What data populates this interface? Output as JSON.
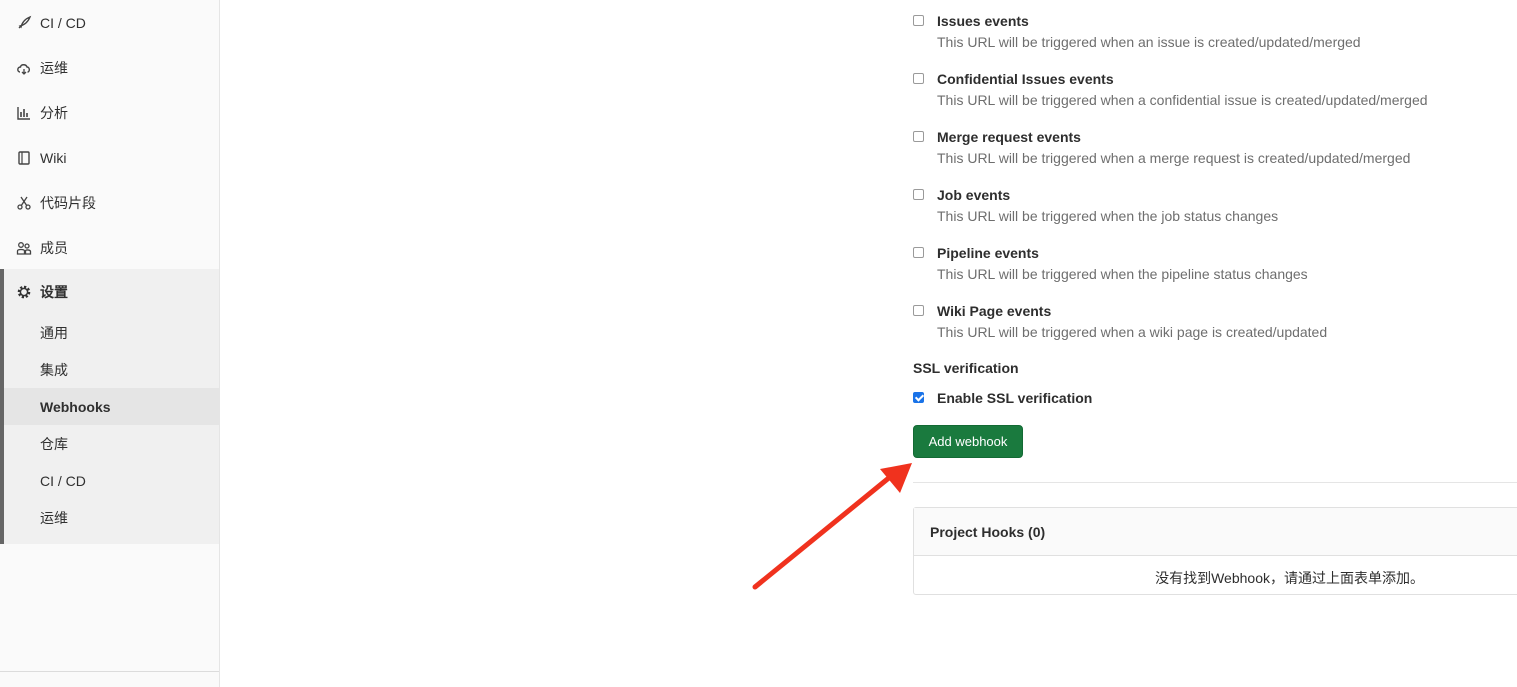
{
  "sidebar": {
    "items": [
      {
        "label": "CI / CD",
        "icon": "rocket-icon"
      },
      {
        "label": "运维",
        "icon": "cloud-icon"
      },
      {
        "label": "分析",
        "icon": "chart-icon"
      },
      {
        "label": "Wiki",
        "icon": "book-icon"
      },
      {
        "label": "代码片段",
        "icon": "scissors-icon"
      },
      {
        "label": "成员",
        "icon": "users-icon"
      },
      {
        "label": "设置",
        "icon": "gear-icon"
      }
    ],
    "settings_sub": [
      "通用",
      "集成",
      "Webhooks",
      "仓库",
      "CI / CD",
      "运维"
    ],
    "active_sub": "Webhooks"
  },
  "events": [
    {
      "title": "Issues events",
      "desc": "This URL will be triggered when an issue is created/updated/merged",
      "checked": false
    },
    {
      "title": "Confidential Issues events",
      "desc": "This URL will be triggered when a confidential issue is created/updated/merged",
      "checked": false
    },
    {
      "title": "Merge request events",
      "desc": "This URL will be triggered when a merge request is created/updated/merged",
      "checked": false
    },
    {
      "title": "Job events",
      "desc": "This URL will be triggered when the job status changes",
      "checked": false
    },
    {
      "title": "Pipeline events",
      "desc": "This URL will be triggered when the pipeline status changes",
      "checked": false
    },
    {
      "title": "Wiki Page events",
      "desc": "This URL will be triggered when a wiki page is created/updated",
      "checked": false
    }
  ],
  "ssl": {
    "heading": "SSL verification",
    "label": "Enable SSL verification",
    "checked": true
  },
  "add_button": "Add webhook",
  "hooks": {
    "title": "Project Hooks (0)",
    "empty": "没有找到Webhook，请通过上面表单添加。"
  },
  "colors": {
    "primary_button": "#1a7a3e",
    "checkbox_checked": "#1a73e8",
    "arrow": "#f0321e"
  }
}
